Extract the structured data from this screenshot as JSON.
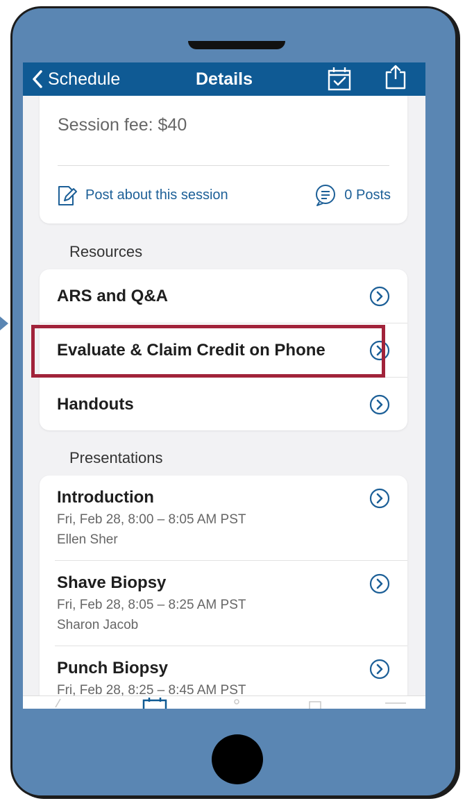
{
  "navbar": {
    "back_label": "Schedule",
    "title": "Details",
    "calendar_icon": "calendar-check-icon",
    "share_icon": "share-icon"
  },
  "session": {
    "fee_text": "Session fee: $40",
    "post_label": "Post about this session",
    "posts_count": "0 Posts"
  },
  "resources": {
    "heading": "Resources",
    "items": [
      {
        "label": "ARS and Q&A"
      },
      {
        "label": "Evaluate & Claim Credit on Phone"
      },
      {
        "label": "Handouts"
      }
    ]
  },
  "presentations": {
    "heading": "Presentations",
    "items": [
      {
        "title": "Introduction",
        "time": "Fri, Feb 28, 8:00 – 8:05 AM PST",
        "speaker": "Ellen Sher"
      },
      {
        "title": "Shave Biopsy",
        "time": "Fri, Feb 28, 8:05 – 8:25 AM PST",
        "speaker": "Sharon Jacob"
      },
      {
        "title": "Punch Biopsy",
        "time": "Fri, Feb 28, 8:25 – 8:45 AM PST",
        "speaker": ""
      }
    ]
  },
  "colors": {
    "navbar": "#0f5a94",
    "link": "#1c5f97",
    "phone_body": "#5a86b3",
    "highlight": "#a1233a"
  }
}
